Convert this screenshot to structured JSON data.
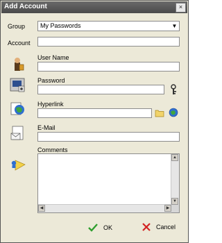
{
  "window": {
    "title": "Add Account",
    "close_glyph": "×"
  },
  "form": {
    "group_label": "Group",
    "group_value": "My Passwords",
    "account_label": "Account",
    "account_value": "",
    "username_label": "User Name",
    "username_value": "",
    "password_label": "Password",
    "password_value": "",
    "hyperlink_label": "Hyperlink",
    "hyperlink_value": "",
    "email_label": "E-Mail",
    "email_value": "",
    "comments_label": "Comments",
    "comments_value": ""
  },
  "buttons": {
    "ok_label": "OK",
    "cancel_label": "Cancel"
  },
  "icons": {
    "user": "user-icon",
    "password": "password-icon",
    "hyperlink": "hyperlink-icon",
    "email": "email-icon",
    "comments": "comments-icon",
    "key": "key-icon",
    "folder": "folder-icon",
    "globe": "globe-icon",
    "ok": "checkmark-icon",
    "cancel": "cancel-x-icon"
  },
  "colors": {
    "ok": "#2e9e2e",
    "cancel": "#d22222",
    "title_bar": "#555555"
  }
}
